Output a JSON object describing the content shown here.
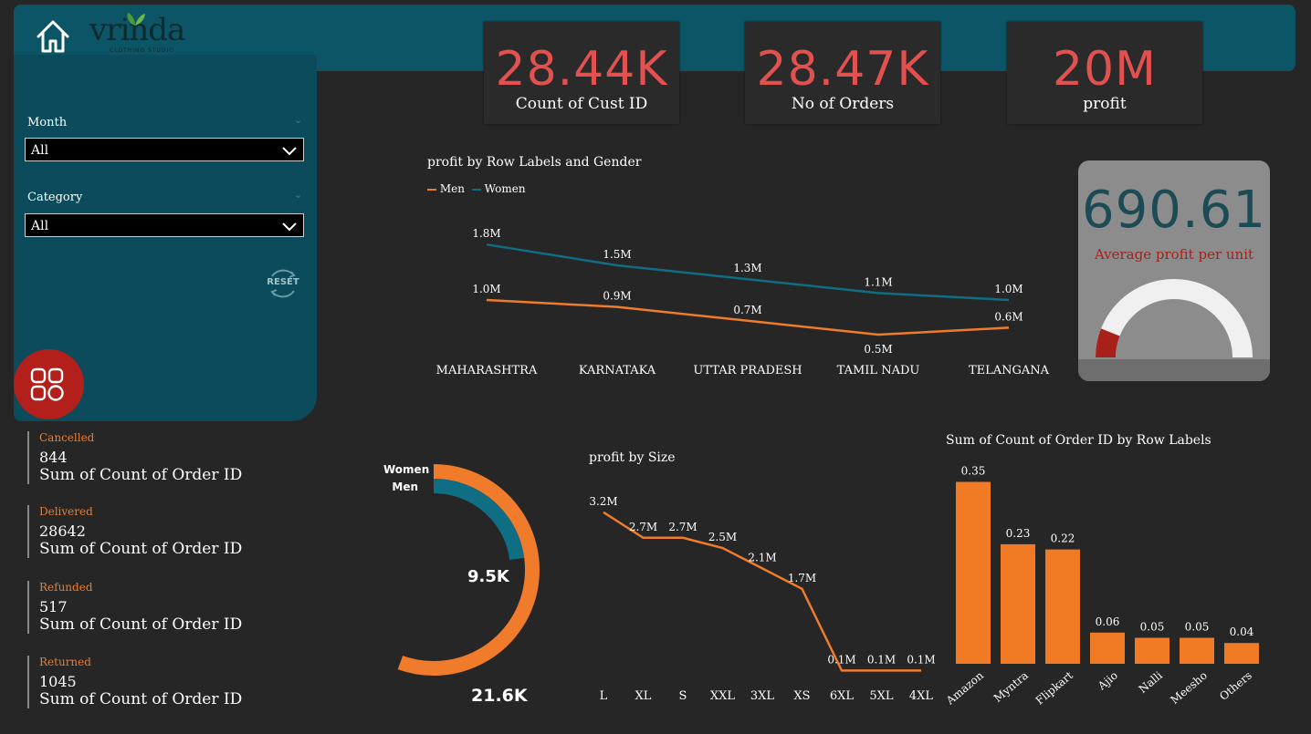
{
  "brand": {
    "name": "vrinda",
    "tagline": "CLOTHING STUDIO"
  },
  "kpis": [
    {
      "value": "28.44K",
      "label": "Count of Cust ID"
    },
    {
      "value": "28.47K",
      "label": "No of Orders"
    },
    {
      "value": "20M",
      "label": "profit"
    }
  ],
  "filters": {
    "month": {
      "label": "Month",
      "value": "All"
    },
    "category": {
      "label": "Category",
      "value": "All"
    },
    "reset_label": "RESET"
  },
  "status_cards": [
    {
      "title": "Cancelled",
      "value": "844",
      "desc": "Sum of Count of Order ID"
    },
    {
      "title": "Delivered",
      "value": "28642",
      "desc": "Sum of Count of Order ID"
    },
    {
      "title": "Refunded",
      "value": "517",
      "desc": "Sum of Count of Order ID"
    },
    {
      "title": "Returned",
      "value": "1045",
      "desc": "Sum of Count of Order ID"
    }
  ],
  "gauge": {
    "value": "690.61",
    "label": "Average profit per unit",
    "fill_fraction": 0.12,
    "color_fill": "#a8201a",
    "color_track": "#f0f0f0"
  },
  "colors": {
    "men": "#ef7b2b",
    "women": "#0f6e84",
    "kpi": "#e0514f",
    "bar": "#f07b24"
  },
  "chart_data": [
    {
      "type": "line",
      "title": "profit by Row Labels and Gender",
      "categories": [
        "MAHARASHTRA",
        "KARNATAKA",
        "UTTAR PRADESH",
        "TAMIL NADU",
        "TELANGANA"
      ],
      "series": [
        {
          "name": "Men",
          "values": [
            1.0,
            0.9,
            0.7,
            0.5,
            0.6
          ],
          "labels": [
            "1.0M",
            "0.9M",
            "0.7M",
            "0.5M",
            "0.6M"
          ]
        },
        {
          "name": "Women",
          "values": [
            1.8,
            1.5,
            1.3,
            1.1,
            1.0
          ],
          "labels": [
            "1.8M",
            "1.5M",
            "1.3M",
            "1.1M",
            "1.0M"
          ]
        }
      ],
      "legend": "top-left",
      "grid": false
    },
    {
      "type": "pie",
      "title": "",
      "slices": [
        {
          "name": "Women",
          "value": 21.6,
          "label": "21.6K"
        },
        {
          "name": "Men",
          "value": 9.5,
          "label": "9.5K"
        }
      ]
    },
    {
      "type": "line",
      "title": "profit by Size",
      "categories": [
        "L",
        "XL",
        "S",
        "XXL",
        "3XL",
        "XS",
        "6XL",
        "5XL",
        "4XL"
      ],
      "values": [
        3.2,
        2.7,
        2.7,
        2.5,
        2.1,
        1.7,
        0.1,
        0.1,
        0.1
      ],
      "labels": [
        "3.2M",
        "2.7M",
        "2.7M",
        "2.5M",
        "2.1M",
        "1.7M",
        "0.1M",
        "0.1M",
        "0.1M"
      ]
    },
    {
      "type": "bar",
      "title": "Sum of Count of Order ID by Row Labels",
      "categories": [
        "Amazon",
        "Myntra",
        "Flipkart",
        "Ajio",
        "Nalli",
        "Meesho",
        "Others"
      ],
      "values": [
        0.35,
        0.23,
        0.22,
        0.06,
        0.05,
        0.05,
        0.04
      ],
      "labels": [
        "0.35",
        "0.23",
        "0.22",
        "0.06",
        "0.05",
        "0.05",
        "0.04"
      ]
    }
  ]
}
